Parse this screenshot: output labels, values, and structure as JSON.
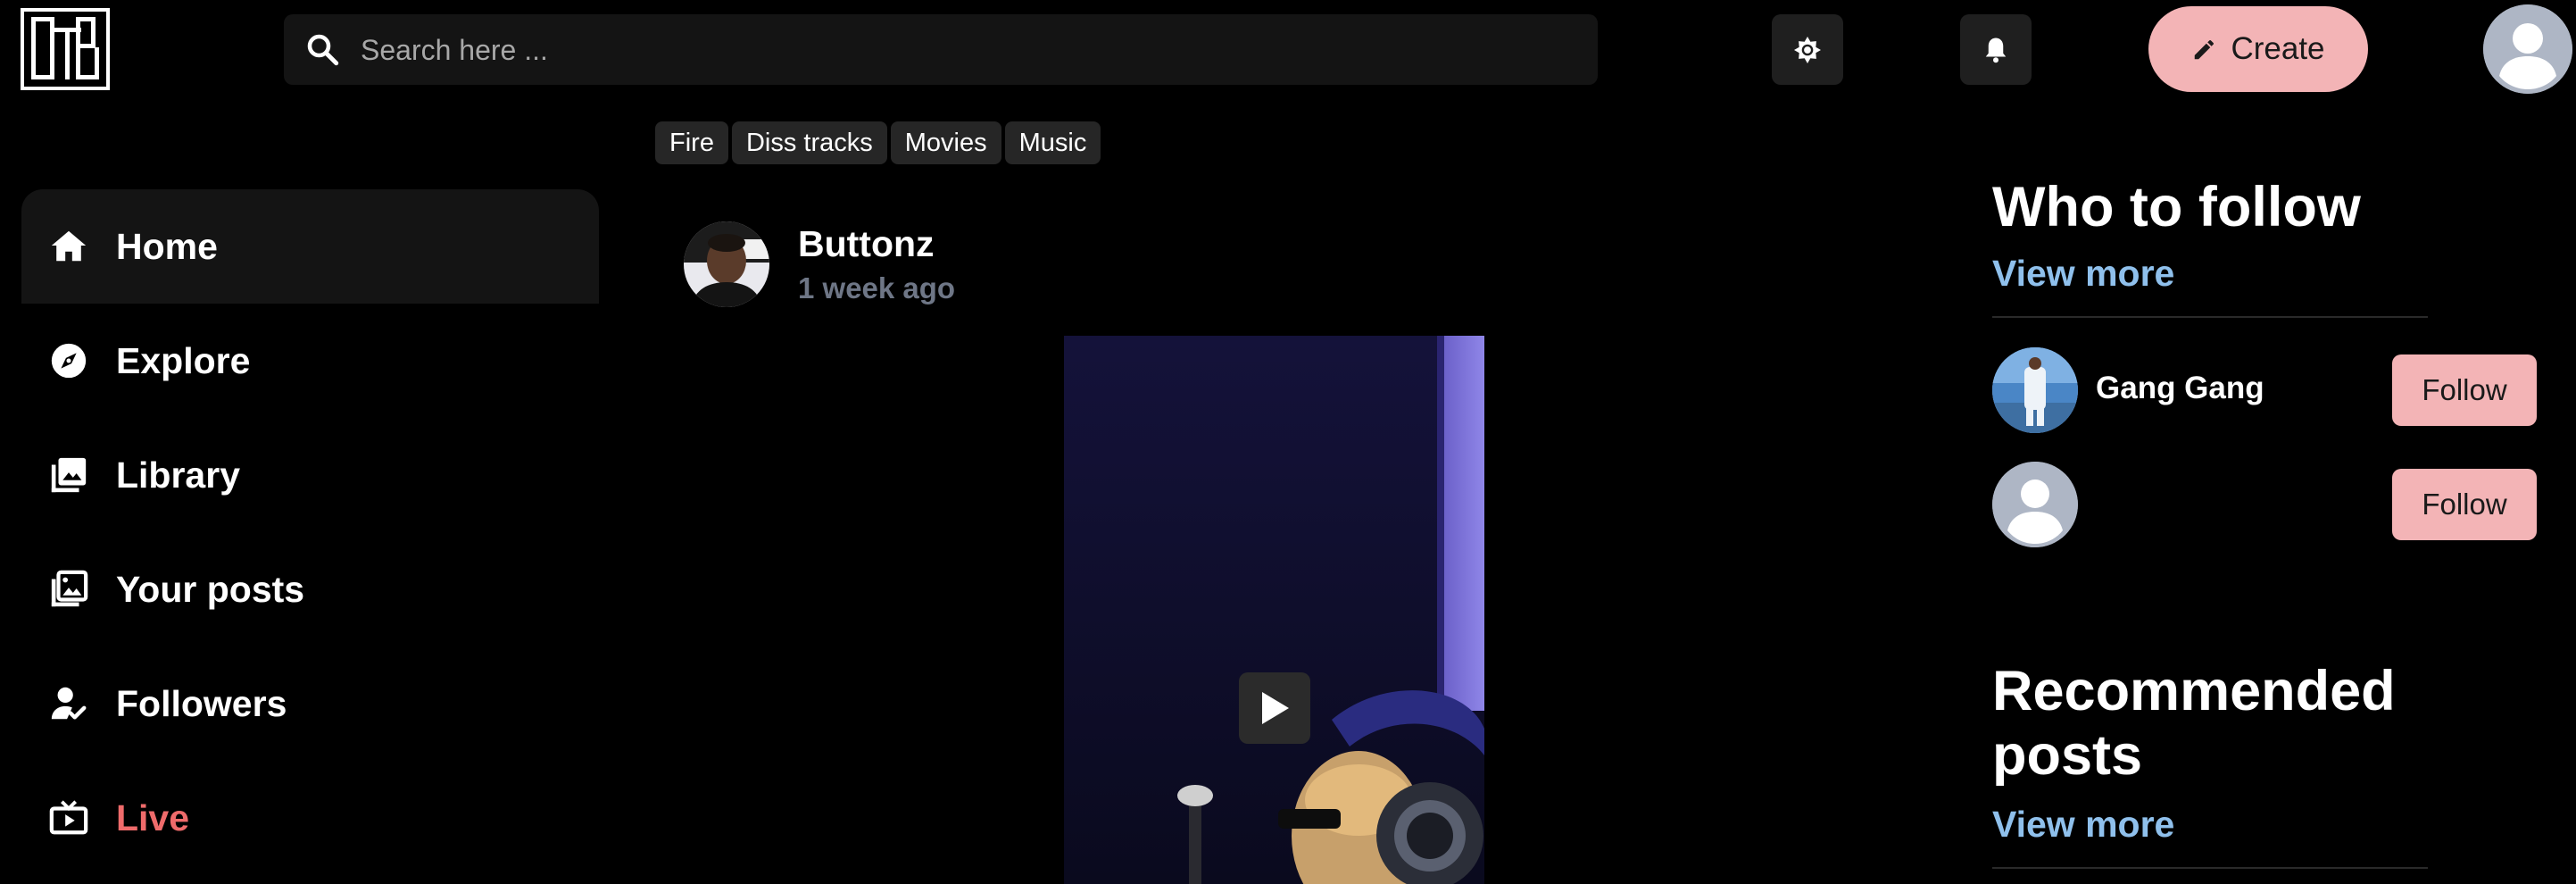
{
  "logo": {
    "text": "OTB"
  },
  "search": {
    "placeholder": "Search here ..."
  },
  "header": {
    "create_label": "Create"
  },
  "tags": [
    "Fire",
    "Diss tracks",
    "Movies",
    "Music"
  ],
  "sidebar": {
    "items": [
      {
        "label": "Home",
        "icon": "home-icon",
        "active": true
      },
      {
        "label": "Explore",
        "icon": "compass-icon"
      },
      {
        "label": "Library",
        "icon": "library-icon"
      },
      {
        "label": "Your posts",
        "icon": "photos-icon"
      },
      {
        "label": "Followers",
        "icon": "follower-check-icon"
      },
      {
        "label": "Live",
        "icon": "tv-icon",
        "color": "#ef6b6b"
      }
    ]
  },
  "post": {
    "author": "Buttonz",
    "time": "1 week ago"
  },
  "who_to_follow": {
    "title": "Who to follow",
    "view_more": "View more",
    "users": [
      {
        "name": "Gang Gang",
        "button": "Follow"
      },
      {
        "name": "",
        "button": "Follow"
      }
    ]
  },
  "recommended": {
    "title": "Recommended posts",
    "view_more": "View more"
  },
  "colors": {
    "accent_pink": "#f3b4b6",
    "link_blue": "#8fc0ec",
    "live_red": "#ef6b6b"
  }
}
